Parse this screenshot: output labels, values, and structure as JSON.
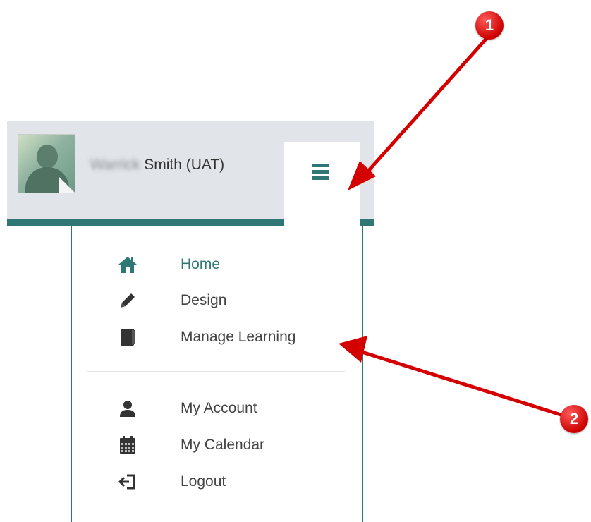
{
  "user": {
    "name_blurred": "Warrick",
    "name_visible": "Smith (UAT)"
  },
  "menu": {
    "primary": [
      {
        "label": "Home",
        "icon": "home-icon",
        "active": true
      },
      {
        "label": "Design",
        "icon": "pencil-icon",
        "active": false
      },
      {
        "label": "Manage Learning",
        "icon": "book-icon",
        "active": false
      }
    ],
    "secondary": [
      {
        "label": "My Account",
        "icon": "user-icon"
      },
      {
        "label": "My Calendar",
        "icon": "calendar-icon"
      },
      {
        "label": "Logout",
        "icon": "logout-icon"
      }
    ]
  },
  "callouts": {
    "one": "1",
    "two": "2"
  },
  "colors": {
    "accent": "#2e7775",
    "header_bg": "#e1e4e8",
    "callout": "#dd0000"
  }
}
